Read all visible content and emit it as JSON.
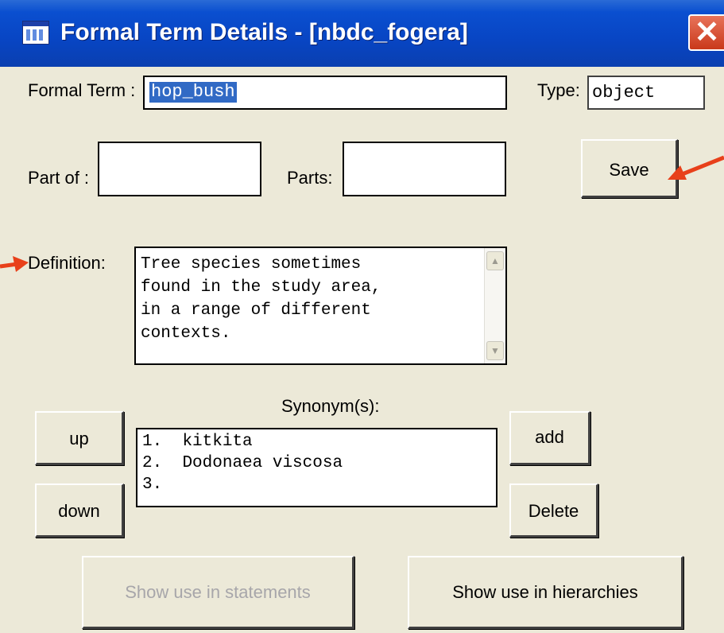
{
  "window": {
    "title": "Formal Term Details - [nbdc_fogera]",
    "close_glyph": "✕"
  },
  "form": {
    "formal_term_label": "Formal Term :",
    "formal_term_value": "hop_bush",
    "type_label": "Type:",
    "type_value": "object",
    "part_of_label": "Part of :",
    "part_of_value": "",
    "parts_label": "Parts:",
    "parts_value": "",
    "save_label": "Save",
    "definition_label": "Definition:",
    "definition_text": "Tree species sometimes\nfound in the study area,\nin a range of different\ncontexts.",
    "synonyms_label": "Synonym(s):",
    "synonyms": [
      {
        "index": "1.",
        "text": "kitkita"
      },
      {
        "index": "2.",
        "text": "Dodonaea viscosa"
      },
      {
        "index": "3.",
        "text": ""
      }
    ],
    "up_label": "up",
    "down_label": "down",
    "add_label": "add",
    "delete_label": "Delete",
    "show_statements_label": "Show use in statements",
    "show_hierarchies_label": "Show use in hierarchies"
  },
  "colors": {
    "titlebar": "#0a4fd0",
    "dialog_bg": "#ece9d8",
    "selection": "#316ac5",
    "annotation_arrow": "#e8401a"
  },
  "icons": {
    "scroll_up": "▲",
    "scroll_down": "▼"
  }
}
